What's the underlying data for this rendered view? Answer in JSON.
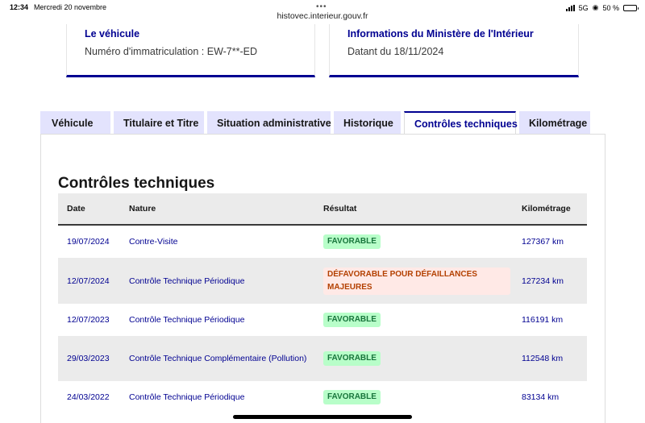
{
  "status_bar": {
    "time": "12:34",
    "date": "Mercredi 20 novembre",
    "network": "5G",
    "battery": "50 %",
    "url": "histovec.interieur.gouv.fr"
  },
  "cards": [
    {
      "title": "Le véhicule",
      "text": "Numéro d'immatriculation : EW-7**-ED"
    },
    {
      "title": "Informations du Ministère de l'Intérieur",
      "text": "Datant du 18/11/2024"
    }
  ],
  "tabs": [
    {
      "label": "Véhicule",
      "active": false
    },
    {
      "label": "Titulaire et Titre",
      "active": false
    },
    {
      "label": "Situation administrative",
      "active": false
    },
    {
      "label": "Historique",
      "active": false
    },
    {
      "label": "Contrôles techniques",
      "active": true
    },
    {
      "label": "Kilométrage",
      "active": false
    }
  ],
  "section_title": "Contrôles techniques",
  "table": {
    "headers": [
      "Date",
      "Nature",
      "Résultat",
      "Kilométrage"
    ],
    "rows": [
      {
        "date": "19/07/2024",
        "nature": "Contre-Visite",
        "result": "FAVORABLE",
        "status": "ok",
        "km": "127367 km"
      },
      {
        "date": "12/07/2024",
        "nature": "Contrôle Technique Périodique",
        "result": "DÉFAVORABLE POUR DÉFAILLANCES MAJEURES",
        "status": "ko",
        "km": "127234 km"
      },
      {
        "date": "12/07/2023",
        "nature": "Contrôle Technique Périodique",
        "result": "FAVORABLE",
        "status": "ok",
        "km": "116191 km"
      },
      {
        "date": "29/03/2023",
        "nature": "Contrôle Technique Complémentaire (Pollution)",
        "result": "FAVORABLE",
        "status": "ok",
        "km": "112548 km"
      },
      {
        "date": "24/03/2022",
        "nature": "Contrôle Technique Périodique",
        "result": "FAVORABLE",
        "status": "ok",
        "km": "83134 km"
      }
    ]
  },
  "colors": {
    "accent": "#000091",
    "tab_bg": "#e3e3fd",
    "success_bg": "#b8fec9",
    "success_text": "#18753c",
    "error_bg": "#ffe9e6",
    "error_text": "#b34000"
  }
}
